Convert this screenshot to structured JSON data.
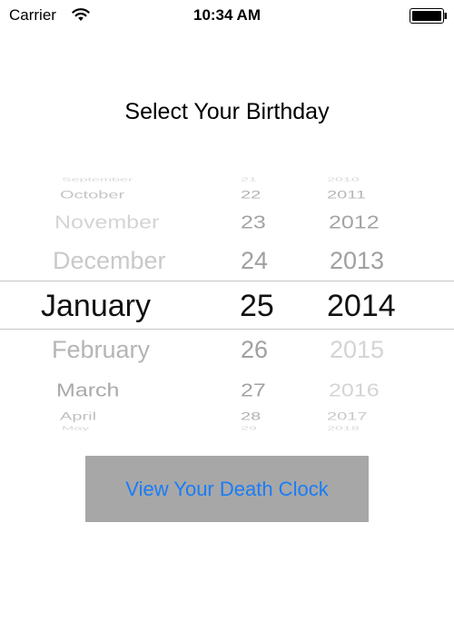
{
  "status_bar": {
    "carrier": "Carrier",
    "time": "10:34 AM",
    "wifi_icon": "wifi-icon",
    "battery_icon": "battery-icon"
  },
  "title": "Select Your Birthday",
  "picker": {
    "months": {
      "above": [
        "September",
        "October",
        "November",
        "December"
      ],
      "selected": "January",
      "below": [
        "February",
        "March",
        "April",
        "May"
      ]
    },
    "days": {
      "above": [
        "21",
        "22",
        "23",
        "24"
      ],
      "selected": "25",
      "below": [
        "26",
        "27",
        "28",
        "29"
      ]
    },
    "years": {
      "above": [
        "2010",
        "2011",
        "2012",
        "2013"
      ],
      "selected": "2014",
      "below": [
        "2015",
        "2016",
        "2017",
        "2018"
      ]
    }
  },
  "button": {
    "label": "View Your Death Clock"
  },
  "colors": {
    "button_background": "#a7a7a7",
    "button_text": "#1a7cf6",
    "picker_selection_line": "#c8c8cc"
  }
}
